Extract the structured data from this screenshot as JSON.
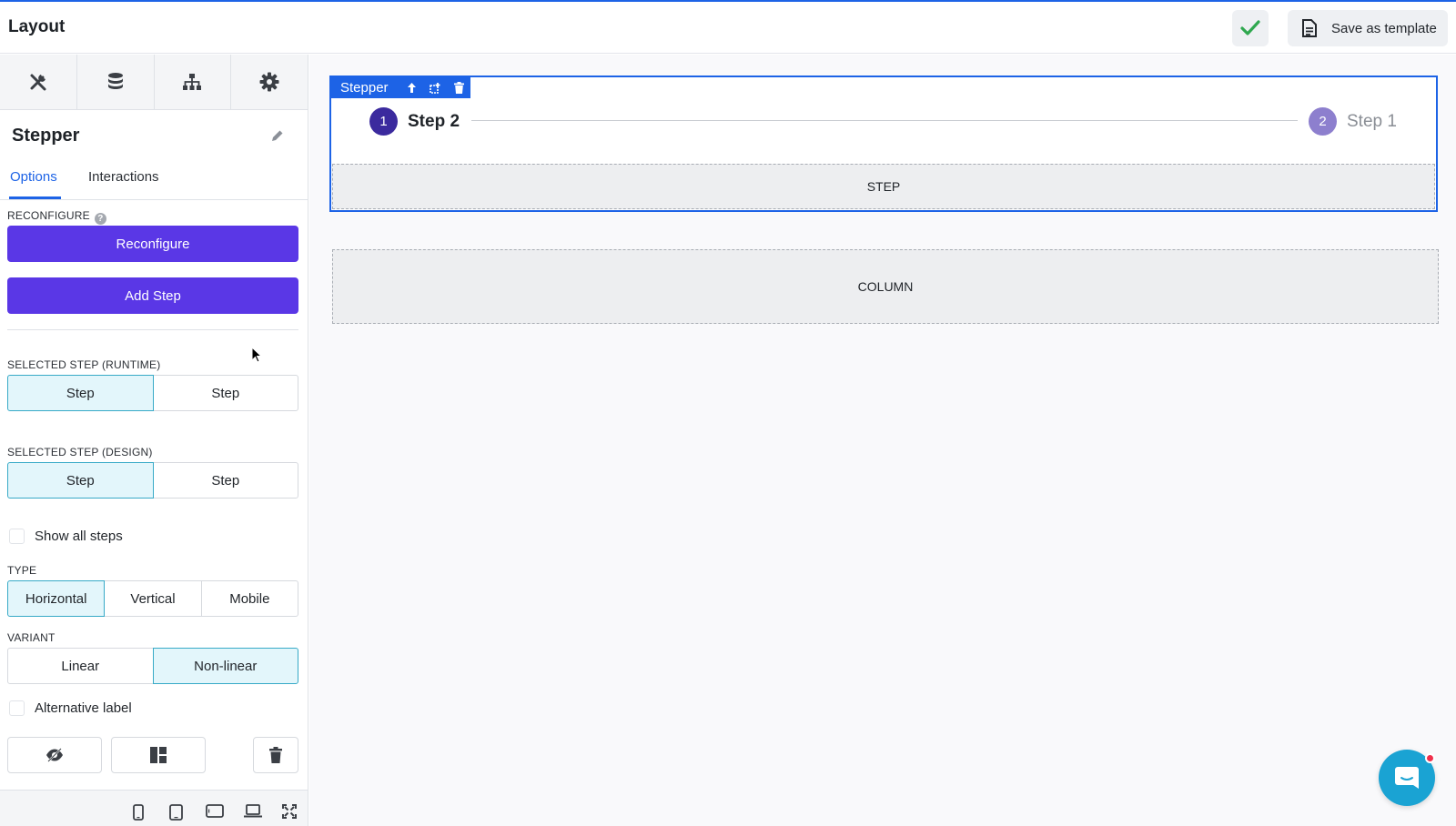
{
  "header": {
    "title": "Layout",
    "save_template_label": "Save as template"
  },
  "sidebar": {
    "tabs": [
      {
        "icon": "tools-icon"
      },
      {
        "icon": "database-icon"
      },
      {
        "icon": "hierarchy-icon"
      },
      {
        "icon": "gear-icon"
      }
    ],
    "component_title": "Stepper",
    "subtabs": {
      "options": "Options",
      "interactions": "Interactions"
    },
    "reconfigure_label": "RECONFIGURE",
    "reconfigure_button": "Reconfigure",
    "add_step_button": "Add Step",
    "selected_step_runtime": {
      "label": "SELECTED STEP (RUNTIME)",
      "options": [
        "Step",
        "Step"
      ],
      "selected_index": 0
    },
    "selected_step_design": {
      "label": "SELECTED STEP (DESIGN)",
      "options": [
        "Step",
        "Step"
      ],
      "selected_index": 0
    },
    "show_all_steps": {
      "label": "Show all steps",
      "checked": false
    },
    "type": {
      "label": "TYPE",
      "options": [
        "Horizontal",
        "Vertical",
        "Mobile"
      ],
      "selected_index": 0
    },
    "variant": {
      "label": "VARIANT",
      "options": [
        "Linear",
        "Non-linear"
      ],
      "selected_index": 1
    },
    "alternative_label": {
      "label": "Alternative label",
      "checked": false
    },
    "devices": [
      "mobile-icon",
      "tablet-icon",
      "tablet-landscape-icon",
      "laptop-icon",
      "fullscreen-icon"
    ]
  },
  "canvas": {
    "stepper_tag": "Stepper",
    "steps": [
      {
        "number": "1",
        "label": "Step 2",
        "active": true
      },
      {
        "number": "2",
        "label": "Step 1",
        "active": false
      }
    ],
    "step_placeholder": "STEP",
    "column_placeholder": "COLUMN"
  },
  "colors": {
    "accent": "#1d63e6",
    "primary_button": "#5a37e6",
    "step_active": "#3b2a9e",
    "step_inactive": "#8d7fce",
    "chat": "#1aa3d3"
  }
}
